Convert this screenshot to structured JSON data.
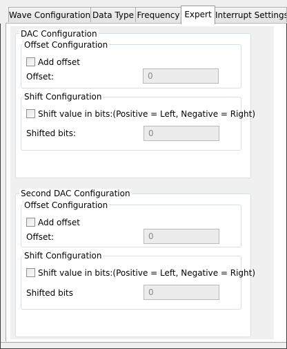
{
  "tabs": [
    {
      "label": "Wave Configuration",
      "active": false
    },
    {
      "label": "Data Type",
      "active": false
    },
    {
      "label": "Frequency",
      "active": false
    },
    {
      "label": "Expert",
      "active": true
    },
    {
      "label": "Interrupt Settings",
      "active": false
    }
  ],
  "dac": {
    "title": "DAC Configuration",
    "offset": {
      "title": "Offset Configuration",
      "checkbox_label": "Add offset",
      "checked": false,
      "field_label": "Offset:",
      "value": "0"
    },
    "shift": {
      "title": "Shift Configuration",
      "checkbox_label": "Shift value in bits:(Positive = Left, Negative = Right)",
      "checked": false,
      "field_label": "Shifted bits:",
      "value": "0"
    }
  },
  "second_dac": {
    "title": "Second DAC Configuration",
    "offset": {
      "title": "Offset Configuration",
      "checkbox_label": "Add offset",
      "checked": false,
      "field_label": "Offset:",
      "value": "0"
    },
    "shift": {
      "title": "Shift Configuration",
      "checkbox_label": "Shift value in bits:(Positive = Left, Negative = Right)",
      "checked": false,
      "field_label": "Shifted bits",
      "value": "0"
    }
  }
}
